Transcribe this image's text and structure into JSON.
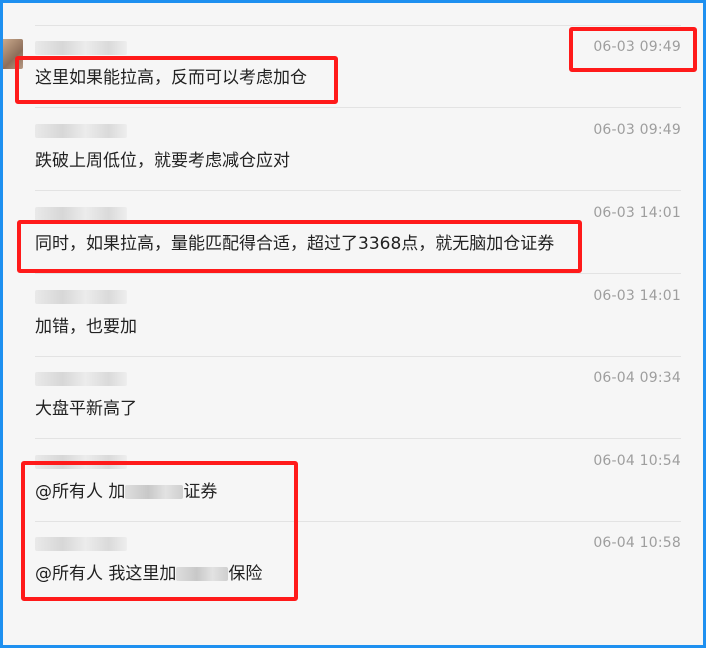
{
  "messages": [
    {
      "time": "06-03 09:49",
      "text": "这里如果能拉高，反而可以考虑加仓"
    },
    {
      "time": "06-03 09:49",
      "text": "跌破上周低位，就要考虑减仓应对"
    },
    {
      "time": "06-03 14:01",
      "text": "同时，如果拉高，量能匹配得合适，超过了3368点，就无脑加仓证券"
    },
    {
      "time": "06-03 14:01",
      "text": "加错，也要加"
    },
    {
      "time": "06-04 09:34",
      "text": "大盘平新高了"
    },
    {
      "time": "06-04 10:54",
      "text_before": "@所有人 加",
      "text_after": "证券"
    },
    {
      "time": "06-04 10:58",
      "text_before": "@所有人 我这里加",
      "text_after": "保险"
    }
  ]
}
